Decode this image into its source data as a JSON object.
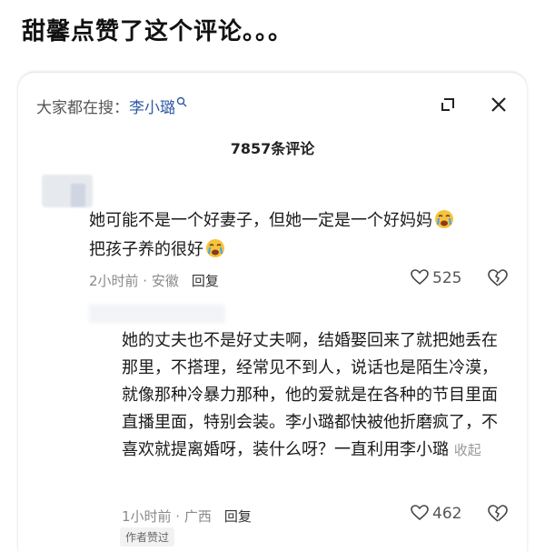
{
  "headline": "甜馨点赞了这个评论。。。",
  "search": {
    "prefix": "大家都在搜：",
    "term": "李小璐"
  },
  "comment_count": "7857条评论",
  "comments": [
    {
      "line1": "她可能不是一个好妻子，但她一定是一个好妈妈",
      "line2": "把孩子养的很好",
      "meta": "2小时前 · 安徽",
      "reply": "回复",
      "likes": "525"
    },
    {
      "text": "她的丈夫也不是好丈夫啊，结婚娶回来了就把她丢在那里，不搭理，经常见不到人，说话也是陌生冷漠，就像那种冷暴力那种，他的爱就是在各种的节目里面直播里面，特别会装。李小璐都快被他折磨疯了，不喜欢就提离婚呀，装什么呀？一直利用李小璐",
      "collapse": "收起",
      "meta": "1小时前 · 广西",
      "reply": "回复",
      "likes": "462",
      "badge": "作者赞过"
    }
  ],
  "colors": {
    "search_term": "#2f5aa7",
    "meta": "#8a8a8a"
  }
}
